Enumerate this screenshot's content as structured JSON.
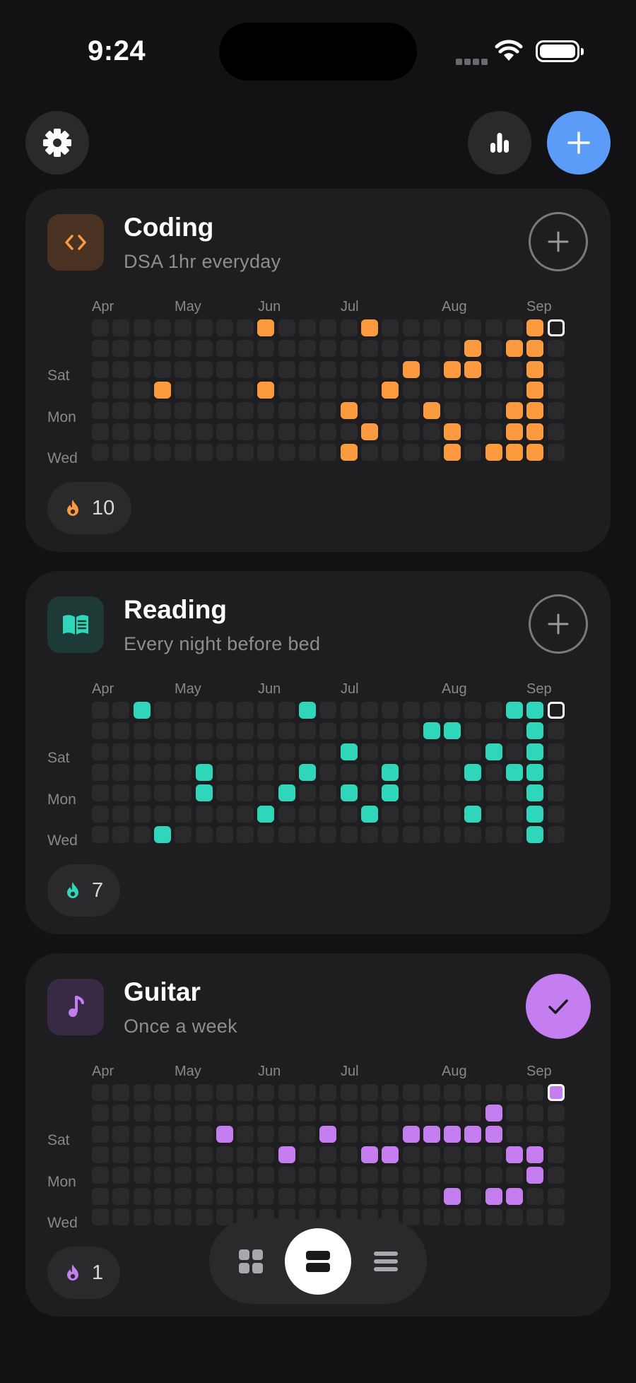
{
  "status_bar": {
    "time": "9:24"
  },
  "toolbar": {
    "settings_icon": "gear-icon",
    "stats_icon": "bar-chart-icon",
    "add_icon": "plus-icon",
    "accent": "#5a9cf8"
  },
  "months": [
    "Apr",
    "May",
    "Jun",
    "Jul",
    "Aug",
    "Sep"
  ],
  "day_labels": [
    "Sat",
    "Mon",
    "Wed"
  ],
  "habits": [
    {
      "title": "Coding",
      "subtitle": "DSA 1hr everyday",
      "icon": "code-icon",
      "color": "#fb9a3f",
      "icon_bg": "#4a3222",
      "streak": "10",
      "completed_today": false,
      "done": [
        [
          8,
          0
        ],
        [
          13,
          0
        ],
        [
          21,
          0
        ],
        [
          18,
          1
        ],
        [
          20,
          1
        ],
        [
          21,
          1
        ],
        [
          15,
          2
        ],
        [
          17,
          2
        ],
        [
          18,
          2
        ],
        [
          21,
          2
        ],
        [
          3,
          3
        ],
        [
          8,
          3
        ],
        [
          14,
          3
        ],
        [
          21,
          3
        ],
        [
          12,
          4
        ],
        [
          16,
          4
        ],
        [
          20,
          4
        ],
        [
          21,
          4
        ],
        [
          13,
          5
        ],
        [
          17,
          5
        ],
        [
          20,
          5
        ],
        [
          21,
          5
        ],
        [
          12,
          6
        ],
        [
          17,
          6
        ],
        [
          19,
          6
        ],
        [
          20,
          6
        ],
        [
          21,
          6
        ]
      ]
    },
    {
      "title": "Reading",
      "subtitle": "Every night before bed",
      "icon": "book-icon",
      "color": "#2fd6b9",
      "icon_bg": "#1e3a36",
      "streak": "7",
      "completed_today": false,
      "done": [
        [
          2,
          0
        ],
        [
          10,
          0
        ],
        [
          20,
          0
        ],
        [
          21,
          0
        ],
        [
          16,
          1
        ],
        [
          17,
          1
        ],
        [
          21,
          1
        ],
        [
          12,
          2
        ],
        [
          19,
          2
        ],
        [
          21,
          2
        ],
        [
          5,
          3
        ],
        [
          10,
          3
        ],
        [
          14,
          3
        ],
        [
          18,
          3
        ],
        [
          20,
          3
        ],
        [
          21,
          3
        ],
        [
          5,
          4
        ],
        [
          9,
          4
        ],
        [
          12,
          4
        ],
        [
          14,
          4
        ],
        [
          21,
          4
        ],
        [
          8,
          5
        ],
        [
          13,
          5
        ],
        [
          18,
          5
        ],
        [
          21,
          5
        ],
        [
          3,
          6
        ],
        [
          21,
          6
        ]
      ]
    },
    {
      "title": "Guitar",
      "subtitle": "Once a week",
      "icon": "music-note-icon",
      "color": "#c47ef0",
      "icon_bg": "#382a45",
      "streak": "1",
      "completed_today": true,
      "done": [
        [
          19,
          1
        ],
        [
          6,
          2
        ],
        [
          11,
          2
        ],
        [
          15,
          2
        ],
        [
          16,
          2
        ],
        [
          17,
          2
        ],
        [
          18,
          2
        ],
        [
          19,
          2
        ],
        [
          9,
          3
        ],
        [
          13,
          3
        ],
        [
          14,
          3
        ],
        [
          20,
          3
        ],
        [
          21,
          3
        ],
        [
          21,
          4
        ],
        [
          17,
          5
        ],
        [
          19,
          5
        ],
        [
          20,
          5
        ]
      ]
    }
  ],
  "bottom_nav": {
    "items": [
      "grid-view-icon",
      "card-view-icon",
      "list-view-icon"
    ],
    "active": "card-view-icon"
  }
}
